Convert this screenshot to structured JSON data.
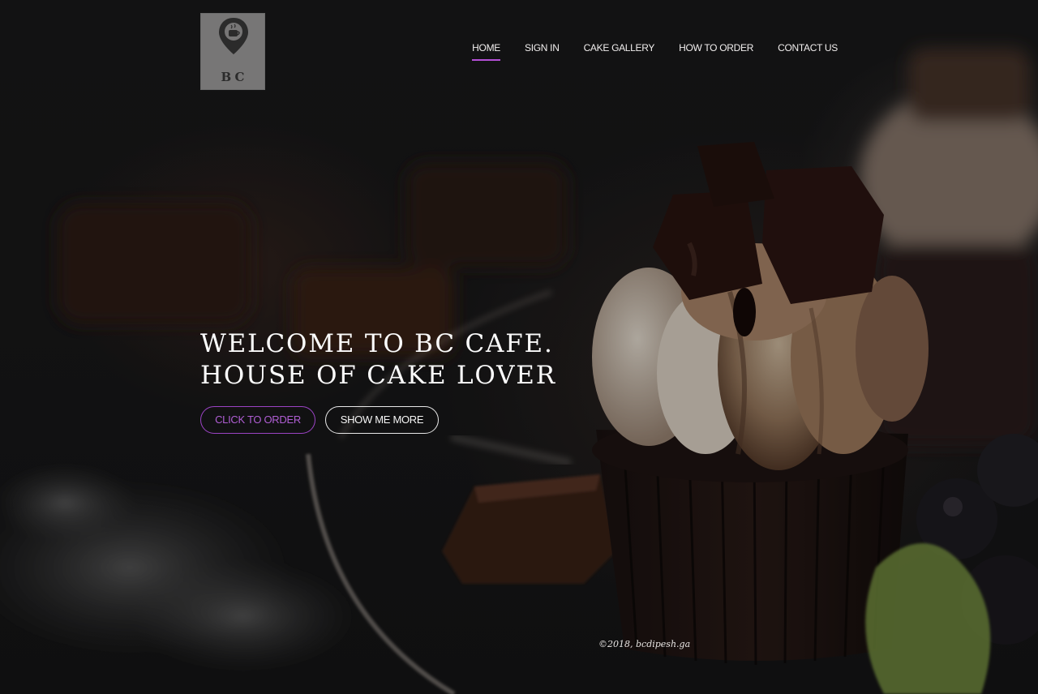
{
  "logo": {
    "text": "BC",
    "icon": "map-pin-coffee-icon"
  },
  "nav": {
    "items": [
      {
        "label": "HOME",
        "active": true
      },
      {
        "label": "SIGN IN",
        "active": false
      },
      {
        "label": "CAKE GALLERY",
        "active": false
      },
      {
        "label": "HOW TO ORDER",
        "active": false
      },
      {
        "label": "CONTACT US",
        "active": false
      }
    ]
  },
  "hero": {
    "headline_line1": "WELCOME TO BC CAFE.",
    "headline_line2": "HOUSE OF CAKE LOVER",
    "primary_button": "CLICK TO ORDER",
    "secondary_button": "SHOW ME MORE",
    "background": "cupcake-photo"
  },
  "footer": {
    "text": "©2018, bcdipesh.ga"
  },
  "colors": {
    "accent": "#b44fd6",
    "background": "#1b1b1c",
    "text": "#f5f5f5"
  }
}
